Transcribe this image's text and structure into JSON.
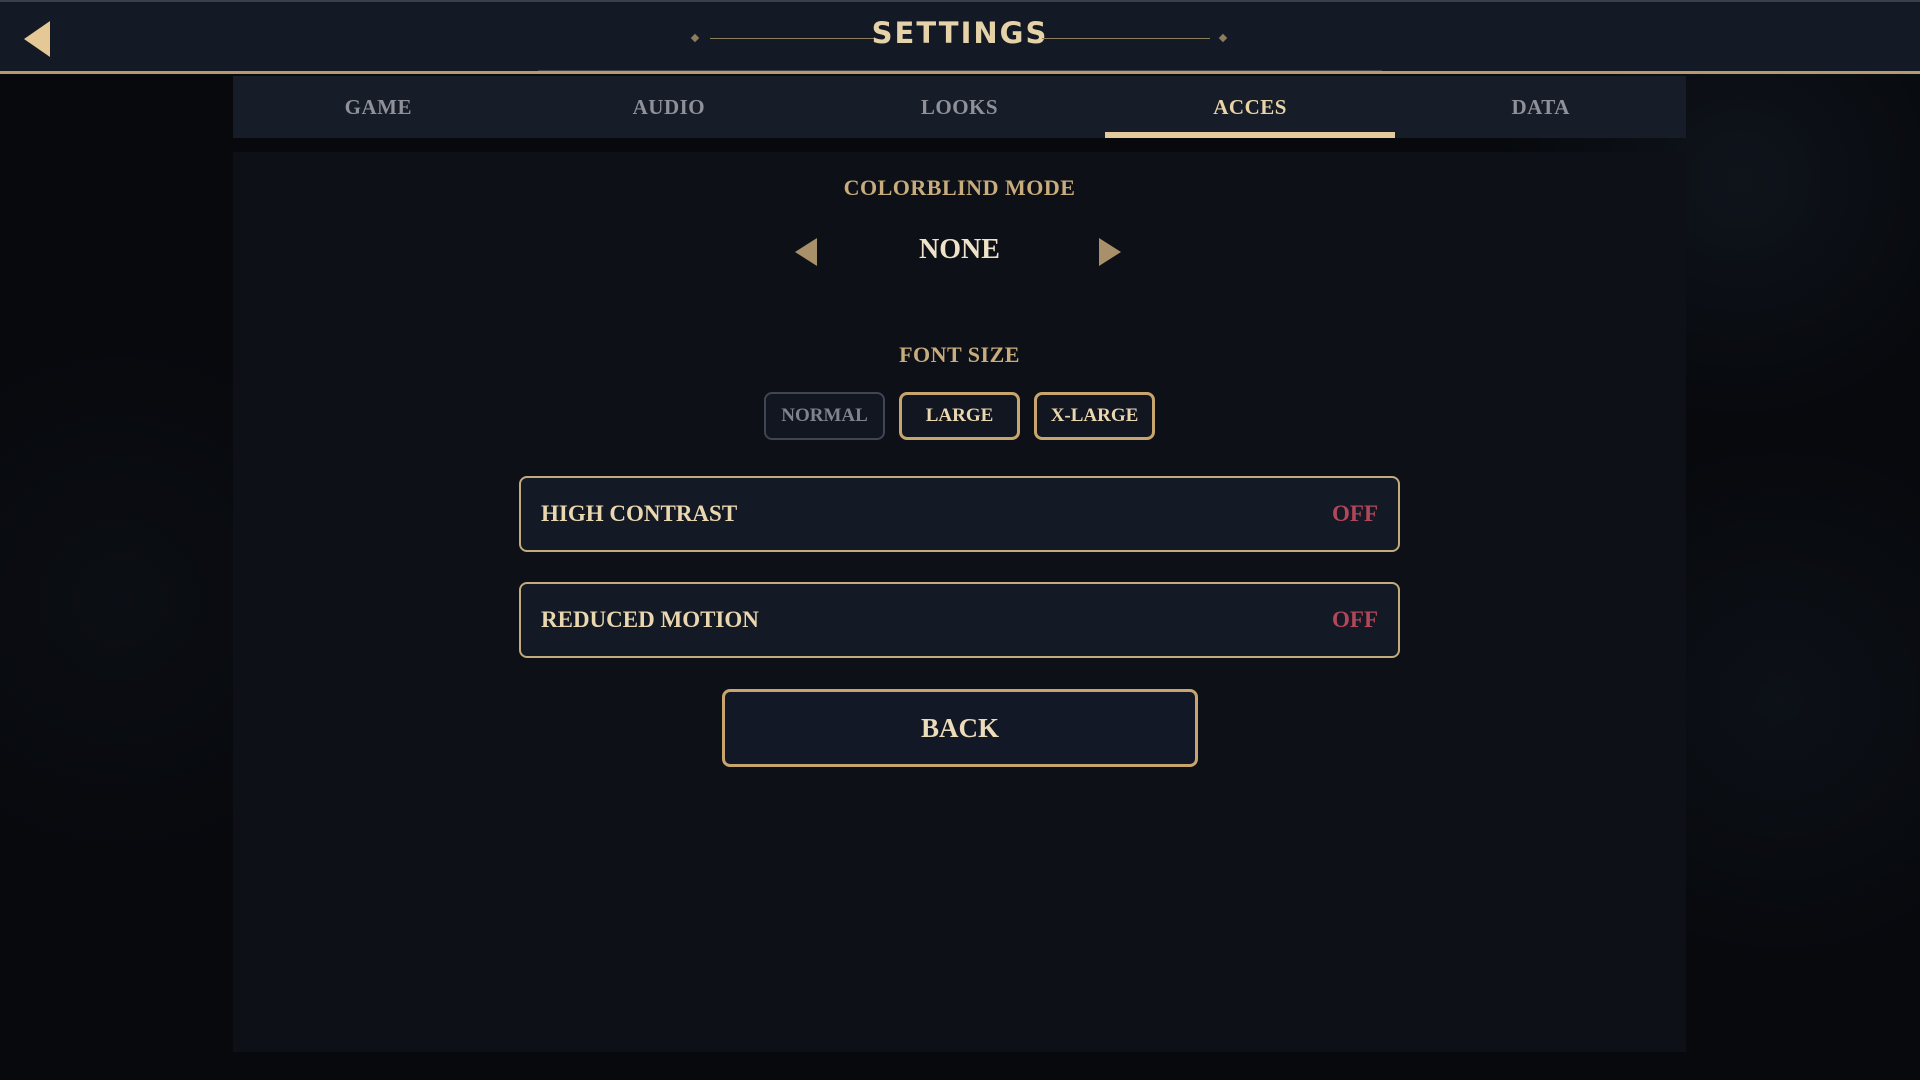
{
  "header": {
    "title": "SETTINGS"
  },
  "tabs": [
    {
      "label": "GAME",
      "active": false
    },
    {
      "label": "AUDIO",
      "active": false
    },
    {
      "label": "LOOKS",
      "active": false
    },
    {
      "label": "ACCES",
      "active": true
    },
    {
      "label": "DATA",
      "active": false
    }
  ],
  "colorblind": {
    "label": "COLORBLIND MODE",
    "value": "NONE"
  },
  "font_size": {
    "label": "FONT SIZE",
    "options": [
      "NORMAL",
      "LARGE",
      "X-LARGE"
    ]
  },
  "toggles": [
    {
      "label": "HIGH CONTRAST",
      "value": "OFF"
    },
    {
      "label": "REDUCED MOTION",
      "value": "OFF"
    }
  ],
  "back_label": "BACK",
  "icons": {
    "header_back": "back-arrow-icon",
    "prev": "triangle-left-icon",
    "next": "triangle-right-icon"
  },
  "colors": {
    "accent_gold": "#c8a56c",
    "off_red": "#b2475a",
    "bar_bg": "#131925"
  }
}
